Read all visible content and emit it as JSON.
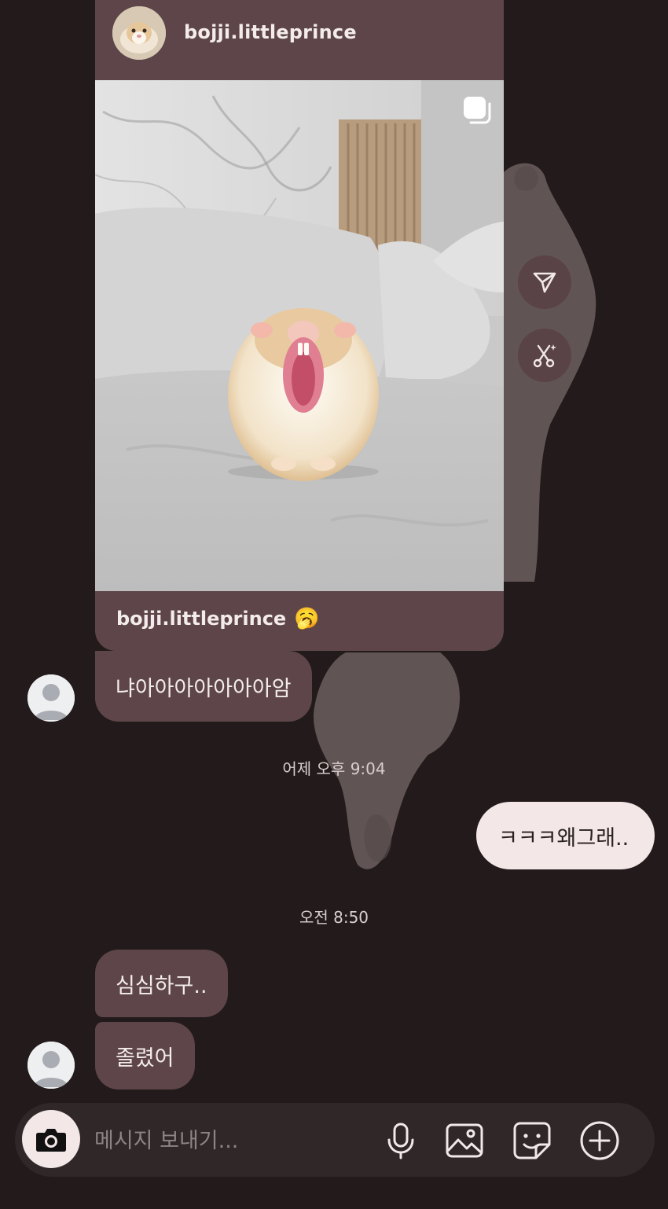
{
  "post": {
    "username": "bojji.littleprince",
    "caption_username": "bojji.littleprince",
    "caption_emoji": "🥱"
  },
  "messages": {
    "incoming_1": "냐아아아아아아아암",
    "timestamp_1": "어제 오후 9:04",
    "outgoing_1": "ㅋㅋㅋ왜그래..",
    "timestamp_2": "오전 8:50",
    "incoming_2": "심심하구..",
    "incoming_3": "졸렸어"
  },
  "composer": {
    "placeholder": "메시지 보내기..."
  },
  "colors": {
    "background": "#231b1b",
    "incoming_bubble": "#5d4549",
    "outgoing_bubble": "#f3e7e8"
  }
}
